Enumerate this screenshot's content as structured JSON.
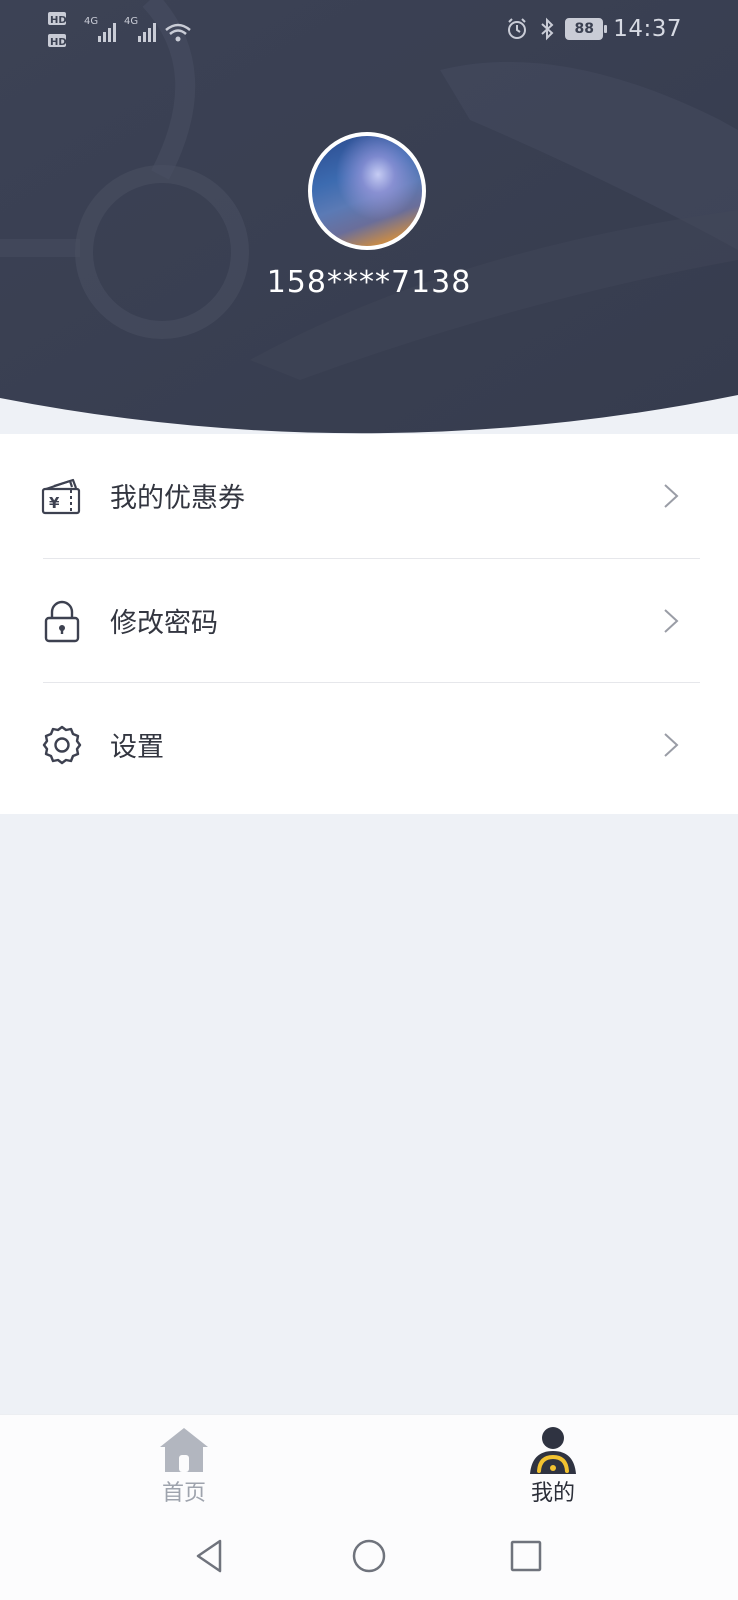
{
  "statusbar": {
    "time": "14:37",
    "battery": "88",
    "sim1": "HD",
    "sim2": "HD",
    "network1": "4G",
    "network2": "4G",
    "icons": [
      "signal-icon",
      "wifi-icon",
      "alarm-icon",
      "bluetooth-icon",
      "battery-icon"
    ]
  },
  "profile": {
    "phone": "158****7138"
  },
  "menu": {
    "items": [
      {
        "label": "我的优惠券",
        "icon": "coupon-wallet-icon"
      },
      {
        "label": "修改密码",
        "icon": "lock-icon"
      },
      {
        "label": "设置",
        "icon": "gear-icon"
      }
    ]
  },
  "tabbar": {
    "tabs": [
      {
        "label": "首页",
        "icon": "home-icon",
        "active": false
      },
      {
        "label": "我的",
        "icon": "driver-icon",
        "active": true
      }
    ]
  },
  "colors": {
    "header_bg": "#3b4152",
    "accent_yellow": "#f2c230",
    "tab_inactive": "#9ea3ad",
    "tab_active": "#2c2f39",
    "page_bg": "#eef1f6"
  }
}
